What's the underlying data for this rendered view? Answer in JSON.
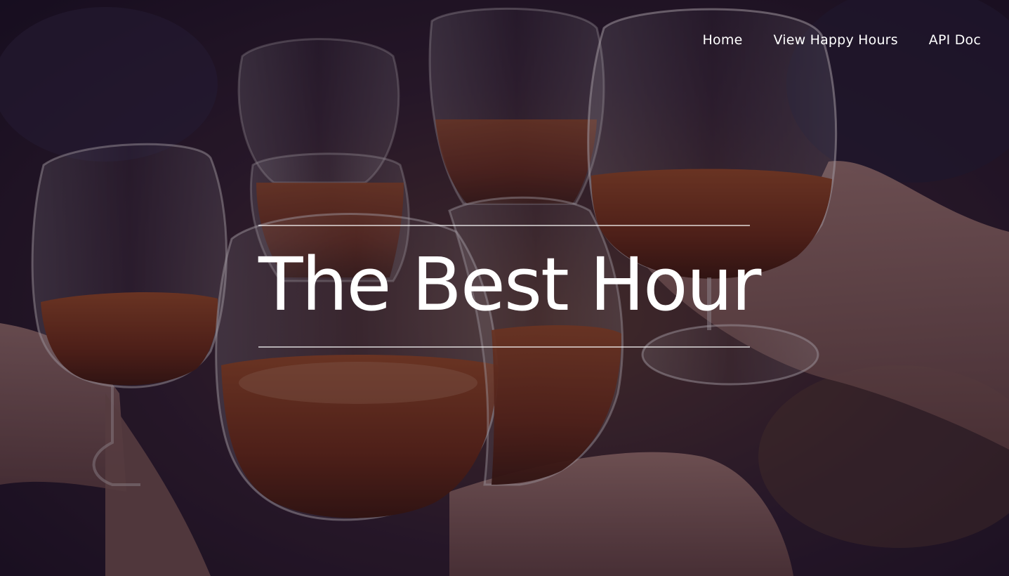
{
  "nav": {
    "items": [
      {
        "label": "Home"
      },
      {
        "label": "View Happy Hours"
      },
      {
        "label": "API Doc"
      }
    ]
  },
  "hero": {
    "title": "The Best Hour",
    "background_image": "glasses-of-beer-toast-photo"
  },
  "colors": {
    "overlay": "#1a0f26",
    "text": "#ffffff",
    "beer": "#7a2e14"
  }
}
